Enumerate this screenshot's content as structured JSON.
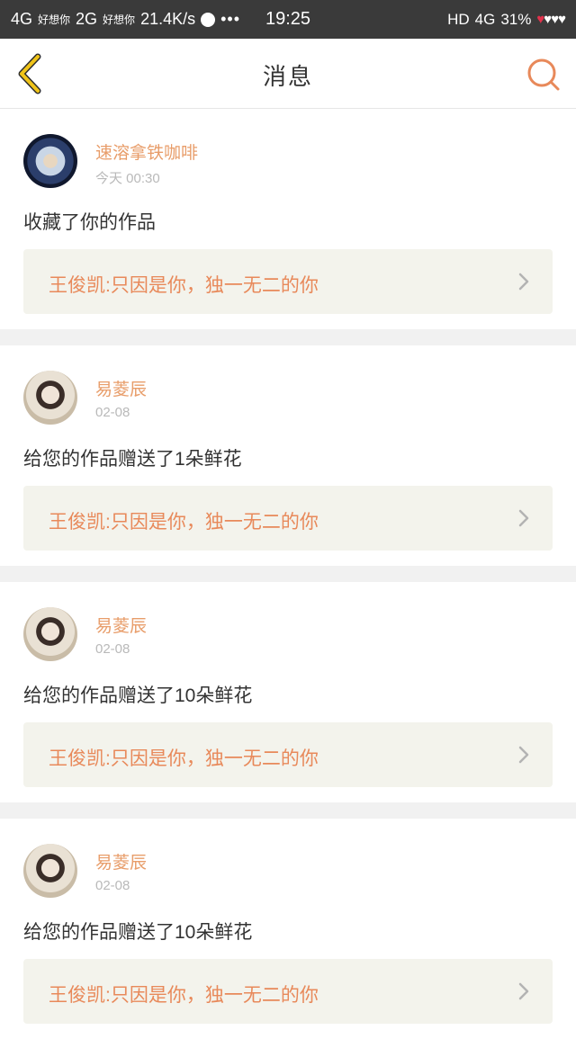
{
  "status_bar": {
    "net1": "4G",
    "carrier1": "好想你",
    "net2": "2G",
    "carrier2": "好想你",
    "speed": "21.4K/s",
    "more": "•••",
    "time": "19:25",
    "hd": "HD",
    "net3": "4G",
    "battery": "31%"
  },
  "header": {
    "title": "消息"
  },
  "messages": [
    {
      "user": "速溶拿铁咖啡",
      "time": "今天 00:30",
      "text": "收藏了你的作品",
      "link": "王俊凯:只因是你，独一无二的你"
    },
    {
      "user": "易菱辰",
      "time": "02-08",
      "text": "给您的作品赠送了1朵鲜花",
      "link": "王俊凯:只因是你，独一无二的你"
    },
    {
      "user": "易菱辰",
      "time": "02-08",
      "text": "给您的作品赠送了10朵鲜花",
      "link": "王俊凯:只因是你，独一无二的你"
    },
    {
      "user": "易菱辰",
      "time": "02-08",
      "text": "给您的作品赠送了10朵鲜花",
      "link": "王俊凯:只因是你，独一无二的你"
    }
  ],
  "colors": {
    "accent": "#e89d6a",
    "back_icon": "#f0c419",
    "search_icon": "#e8895a"
  }
}
